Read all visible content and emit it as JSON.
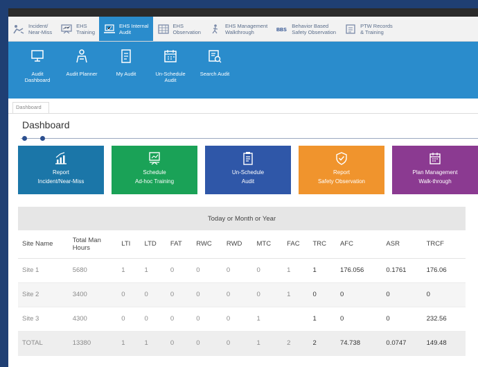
{
  "modules": [
    {
      "line1": "Incident/",
      "line2": "Near-Miss",
      "icon": "injured-person-icon",
      "active": false
    },
    {
      "line1": "EHS",
      "line2": "Training",
      "icon": "training-board-icon",
      "active": false
    },
    {
      "line1": "EHS Internal",
      "line2": "Audit",
      "icon": "audit-laptop-icon",
      "active": true
    },
    {
      "line1": "EHS",
      "line2": "Observation",
      "icon": "observation-grid-icon",
      "active": false
    },
    {
      "line1": "EHS Management",
      "line2": "Walkthrough",
      "icon": "walking-person-icon",
      "active": false
    },
    {
      "line1": "Behavior Based",
      "line2": "Safety Observation",
      "icon": "bbs-icon",
      "active": false
    },
    {
      "line1": "PTW Records",
      "line2": "& Training",
      "icon": "permit-icon",
      "active": false
    }
  ],
  "subnav": [
    {
      "line1": "Audit",
      "line2": "Dashboard",
      "icon": "dashboard-monitor-icon"
    },
    {
      "line1": "Audit Planner",
      "line2": "",
      "icon": "planner-person-icon"
    },
    {
      "line1": "My Audit",
      "line2": "",
      "icon": "document-icon"
    },
    {
      "line1": "Un-Schedule",
      "line2": "Audit",
      "icon": "calendar-icon"
    },
    {
      "line1": "Search Audit",
      "line2": "",
      "icon": "search-list-icon"
    }
  ],
  "breadcrumb": "Dashboard",
  "page_title": "Dashboard",
  "cards": [
    {
      "line1": "Report",
      "line2": "Incident/Near-Miss",
      "color": "#1b76a8",
      "icon": "chart-growth-icon"
    },
    {
      "line1": "Schedule",
      "line2": "Ad-hoc Training",
      "color": "#1aa257",
      "icon": "presentation-icon"
    },
    {
      "line1": "Un-Schedule",
      "line2": "Audit",
      "color": "#2f57a8",
      "icon": "clipboard-icon"
    },
    {
      "line1": "Report",
      "line2": "Safety Observation",
      "color": "#f0942d",
      "icon": "shield-check-icon"
    },
    {
      "line1": "Plan Management",
      "line2": "Walk-through",
      "color": "#8b3a91",
      "icon": "calendar-plan-icon"
    }
  ],
  "table": {
    "banner": "Today or Month or Year",
    "columns": [
      "Site Name",
      "Total Man Hours",
      "LTI",
      "LTD",
      "FAT",
      "RWC",
      "RWD",
      "MTC",
      "FAC",
      "TRC",
      "AFC",
      "ASR",
      "TRCF"
    ],
    "rows": [
      [
        "Site 1",
        "5680",
        "1",
        "1",
        "0",
        "0",
        "0",
        "0",
        "1",
        "1",
        "176.056",
        "0.1761",
        "176.06"
      ],
      [
        "Site 2",
        "3400",
        "0",
        "0",
        "0",
        "0",
        "0",
        "0",
        "1",
        "0",
        "0",
        "0",
        "0"
      ],
      [
        "Site 3",
        "4300",
        "0",
        "0",
        "0",
        "0",
        "0",
        "1",
        "",
        "1",
        "0",
        "0",
        "232.56"
      ],
      [
        "TOTAL",
        "13380",
        "1",
        "1",
        "0",
        "0",
        "0",
        "1",
        "2",
        "2",
        "74.738",
        "0.0747",
        "149.48"
      ]
    ]
  }
}
